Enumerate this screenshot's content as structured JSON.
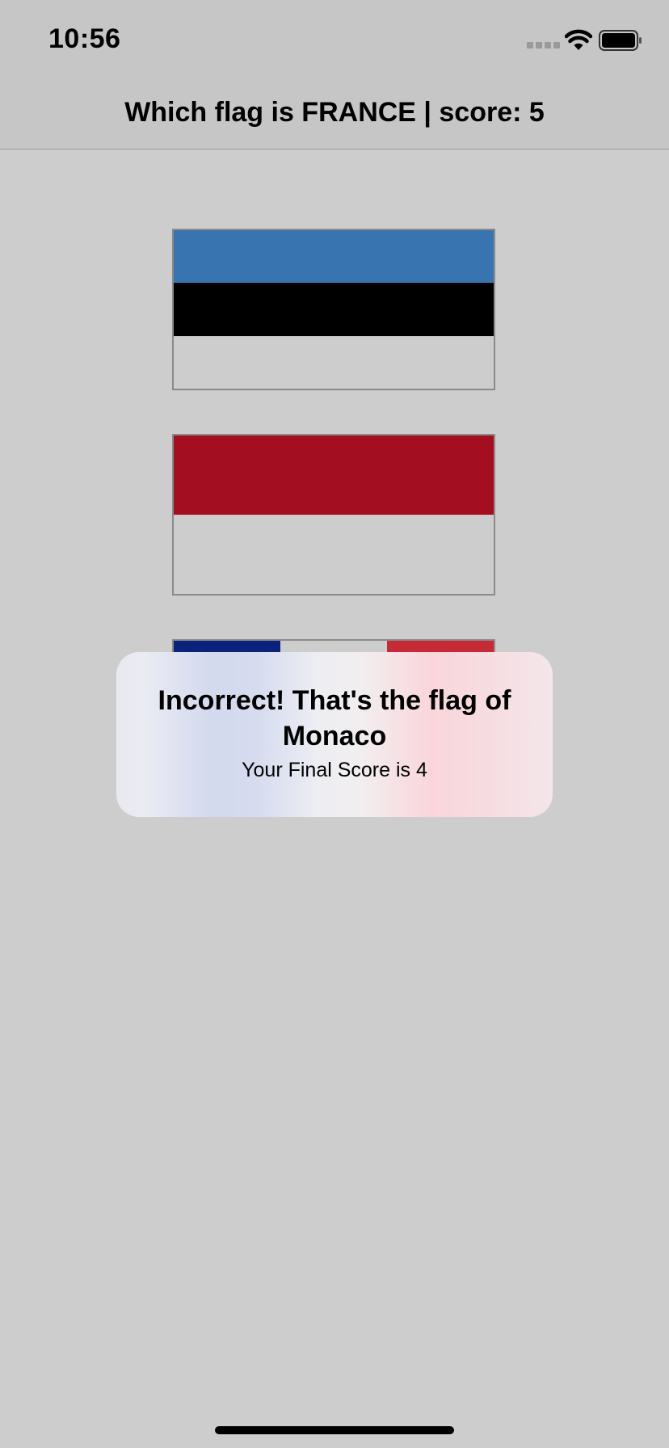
{
  "status_bar": {
    "time": "10:56",
    "signal_icon": "cellular-signal-icon",
    "wifi_icon": "wifi-icon",
    "battery_icon": "battery-icon"
  },
  "nav": {
    "title": "Which flag is FRANCE | score: 5"
  },
  "flags": [
    {
      "id": "estonia",
      "orientation": "horizontal",
      "stripe_colors": [
        "#3875b0",
        "#000000",
        "#cdcdcd"
      ]
    },
    {
      "id": "monaco",
      "orientation": "horizontal",
      "stripe_colors": [
        "#a30e20",
        "#cdcdcd"
      ]
    },
    {
      "id": "france",
      "orientation": "vertical",
      "stripe_colors": [
        "#0b237c",
        "#cdcdcd",
        "#c62a36"
      ]
    }
  ],
  "alert": {
    "title": "Incorrect! That's the flag of Monaco",
    "message": "Your Final Score is 4"
  }
}
